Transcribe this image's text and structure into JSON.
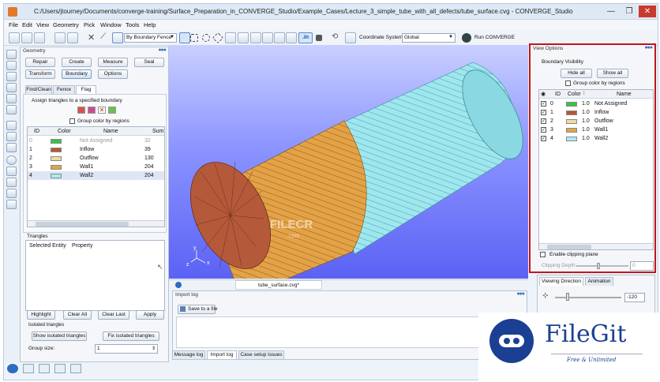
{
  "window": {
    "title": "C:/Users/jtourney/Documents/converge-training/Surface_Preparation_in_CONVERGE_Studio/Example_Cases/Lecture_3_simple_tube_with_all_defects/tube_surface.cvg - CONVERGE_Studio",
    "minimize": "—",
    "maximize": "❐",
    "close": "✕"
  },
  "menu": [
    "File",
    "Edit",
    "View",
    "Geometry",
    "Pick",
    "Window",
    "Tools",
    "Help"
  ],
  "toolbar": {
    "pick_mode": "By Boundary Fence",
    "coord_label": "Coordinate System:",
    "coord_value": "Global",
    "run_label": "Run CONVERGE",
    "in_badge": ".in"
  },
  "geometry_panel": {
    "title": "Geometry",
    "dots": "●●●",
    "buttons": [
      "Repair",
      "Create",
      "Measure",
      "Seal",
      "Transform",
      "Boundary",
      "Options"
    ],
    "subtabs": [
      "Find/Clean",
      "Fence",
      "Flag"
    ],
    "assign_label": "Assign triangles to a specified boundary",
    "group_color": "Group color by regions",
    "table_headers": [
      "ID",
      "Color",
      "Name",
      "Sum"
    ],
    "boundaries": [
      {
        "id": "0",
        "name": "Not Assigned",
        "sum": "32",
        "color": "#2fc843"
      },
      {
        "id": "1",
        "name": "Inflow",
        "sum": "39",
        "color": "#b5563a"
      },
      {
        "id": "2",
        "name": "Outflow",
        "sum": "130",
        "color": "#f0dca0"
      },
      {
        "id": "3",
        "name": "Wall1",
        "sum": "204",
        "color": "#e2a443"
      },
      {
        "id": "4",
        "name": "Wall2",
        "sum": "204",
        "color": "#a9ecf2"
      }
    ],
    "triangles_label": "Triangles",
    "triangles_headers": [
      "Selected Entity",
      "Property"
    ],
    "bottom_buttons": [
      "Highlight",
      "Clear All",
      "Clear Last",
      "Apply"
    ],
    "isolated_label": "Isolated triangles",
    "isolated_buttons": [
      "Show isolated triangles",
      "Fix isolated triangles"
    ],
    "group_size_label": "Group size:",
    "group_size_value": "1"
  },
  "viewport": {
    "axis_x": "x",
    "axis_y": "y",
    "axis_z": "z",
    "watermark": "FILECR",
    "watermark_sub": ".com"
  },
  "doc_tab": "tube_surface.cvg*",
  "import_log": {
    "title": "Import log",
    "save_button": "Save to a file",
    "tabs": [
      "Message log",
      "Import log",
      "Case setup issues"
    ]
  },
  "view_options": {
    "title": "View Options",
    "dots": "●●●",
    "boundary_visibility": "Boundary Visibility",
    "hide_all": "Hide all",
    "show_all": "Show all",
    "group_color": "Group color by regions",
    "headers": [
      "ID",
      "Color",
      "Name"
    ],
    "rows": [
      {
        "id": "0",
        "alpha": "1.0",
        "name": "Not Assigned",
        "color": "#2fc843"
      },
      {
        "id": "1",
        "alpha": "1.0",
        "name": "Inflow",
        "color": "#b5563a"
      },
      {
        "id": "2",
        "alpha": "1.0",
        "name": "Outflow",
        "color": "#f0dca0"
      },
      {
        "id": "3",
        "alpha": "1.0",
        "name": "Wall1",
        "color": "#e2a443"
      },
      {
        "id": "4",
        "alpha": "1.0",
        "name": "Wall2",
        "color": "#a9ecf2"
      }
    ],
    "clip_label": "Enable clipping plane",
    "clip_depth_label": "Clipping Depth:",
    "clip_depth_value": "0",
    "view_tabs": [
      "Viewing Direction",
      "Animation"
    ],
    "view_value": "-120"
  },
  "filegit": {
    "brand": "FileGit",
    "tagline": "Free & Unlimited"
  },
  "colors": {
    "highlight_border": "#c0161c",
    "filegit_blue": "#1b3f92"
  }
}
